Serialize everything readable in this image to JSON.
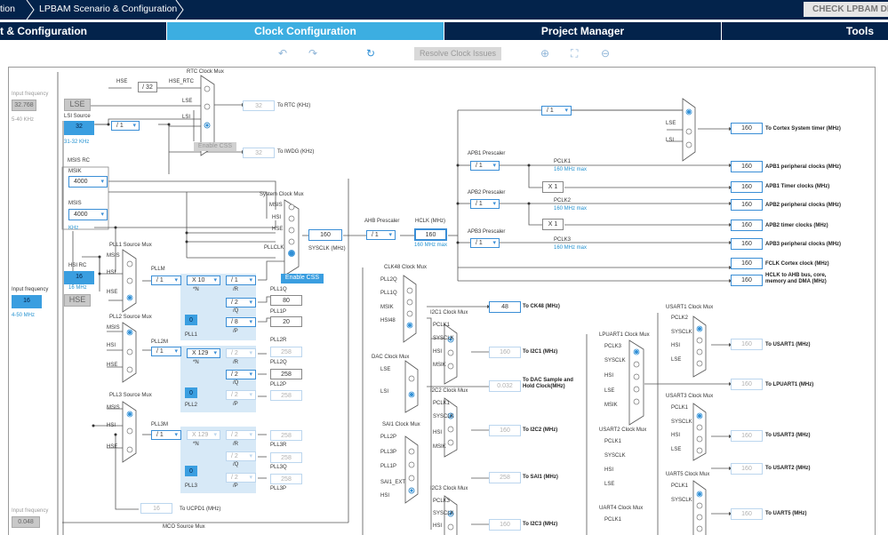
{
  "topbar": {
    "crumb1": "tion",
    "crumb2": "LPBAM Scenario & Configuration",
    "check": "CHECK LPBAM DE"
  },
  "tabs": [
    {
      "label": "t & Configuration"
    },
    {
      "label": "Clock Configuration"
    },
    {
      "label": "Project Manager"
    },
    {
      "label": "Tools"
    }
  ],
  "toolbar": {
    "undo": "↶",
    "redo": "↷",
    "refresh": "↻",
    "resolve": "Resolve Clock Issues",
    "zoom_in": "⊕",
    "fit": "⛶",
    "zoom_out": "⊖"
  },
  "left": {
    "in_freq": "Input frequency",
    "lse_val": "32.768",
    "lse_range": "5-40 KHz",
    "lse": "LSE",
    "lsi_src": "LSI Source",
    "lsi_val": "32",
    "lsi_range": "31-32 KHz",
    "msis_rc": "MSIS RC",
    "msik": "MSIK",
    "msik_val": "4000",
    "msis": "MSIS",
    "msis_val": "4000",
    "khz": "KHz",
    "hsi_rc": "HSI RC",
    "hsi_val": "16",
    "hsi_mhz": "16 MHz",
    "in_freq2": "Input frequency",
    "hse_val": "16",
    "hse": "HSE",
    "hse_range": "4-50 MHz",
    "in_freq3": "Input frequency",
    "in3_val": "0.048"
  },
  "rtc": {
    "title": "RTC Clock Mux",
    "hse": "HSE",
    "div32": "/ 32",
    "hse_rtc": "HSE_RTC",
    "lse": "LSE",
    "lsi": "LSI",
    "rtc_val": "32",
    "rtc_lbl": "To RTC (KHz)",
    "div1": "/ 1",
    "ecss": "Enable CSS",
    "iwdg_val": "32",
    "iwdg_lbl": "To IWDG (KHz)"
  },
  "sys": {
    "title": "System Clock Mux",
    "msis": "MSIS",
    "hsi": "HSI",
    "hse": "HSE",
    "pllclk": "PLLCLK",
    "ecss": "Enable CSS",
    "sysclk_val": "160",
    "sysclk": "SYSCLK (MHz)",
    "ahb": "AHB Prescaler",
    "ahb_div": "/ 1",
    "hclk": "HCLK (MHz)",
    "hclk_val": "160",
    "hclk_max": "160 MHz max"
  },
  "pll1": {
    "src": "PLL1 Source Mux",
    "msis": "MSIS",
    "hsi": "HSI",
    "hse": "HSE",
    "pllm": "PLLM",
    "m": "/ 1",
    "n": "X 10",
    "n_l": "*N",
    "r": "/ 1",
    "r_l": "/R",
    "q": "/ 2",
    "q_l": "/Q",
    "p": "/ 8",
    "p_l": "/P",
    "frac": "0",
    "name": "PLL1",
    "q_lbl": "PLL1Q",
    "q_val": "80",
    "p_lbl": "PLL1P",
    "p_val": "20"
  },
  "pll2": {
    "src": "PLL2 Source Mux",
    "msis": "MSIS",
    "hsi": "HSI",
    "hse": "HSE",
    "pllm": "PLL2M",
    "m": "/ 1",
    "n": "X 129",
    "n_l": "*N",
    "r": "/ 2",
    "r_l": "/R",
    "q": "/ 2",
    "q_l": "/Q",
    "p": "/ 2",
    "p_l": "/P",
    "frac": "0",
    "name": "PLL2",
    "r_lbl": "PLL2R",
    "r_val": "258",
    "q_lbl": "PLL2Q",
    "q_val": "258",
    "p_lbl": "PLL2P",
    "p_val": "258"
  },
  "pll3": {
    "src": "PLL3 Source Mux",
    "msis": "MSIS",
    "hsi": "HSI",
    "hse": "HSE",
    "pllm": "PLL3M",
    "m": "/ 1",
    "n": "X 129",
    "n_l": "*N",
    "r": "/ 2",
    "r_l": "/R",
    "q": "/ 2",
    "q_l": "/Q",
    "p": "/ 2",
    "p_l": "/P",
    "frac": "0",
    "name": "PLL3",
    "r_lbl": "PLL3R",
    "r_val": "258",
    "q_lbl": "PLL3Q",
    "q_val": "258",
    "p_lbl": "PLL3P",
    "p_val": "258"
  },
  "bottom": {
    "ucpd_val": "16",
    "ucpd": "To UCPD1 (MHz)",
    "mco": "MCO Source Mux"
  },
  "right": {
    "div1": "/ 1",
    "lse": "LSE",
    "lsi": "LSI",
    "cortex_val": "160",
    "cortex": "To Cortex System timer (MHz)",
    "apb1": "APB1 Prescaler",
    "apb1_div": "/ 1",
    "pclk1": "PCLK1",
    "pclk1_max": "160 MHz max",
    "x1a": "X 1",
    "apb1p_val": "160",
    "apb1p": "APB1 peripheral clocks (MHz)",
    "apb1t_val": "160",
    "apb1t": "APB1 Timer clocks (MHz)",
    "apb2": "APB2 Prescaler",
    "apb2_div": "/ 1",
    "pclk2": "PCLK2",
    "pclk2_max": "160 MHz max",
    "x1b": "X 1",
    "apb2p_val": "160",
    "apb2p": "APB2 peripheral clocks (MHz)",
    "apb2t_val": "160",
    "apb2t": "APB2 timer clocks (MHz)",
    "apb3": "APB3 Prescaler",
    "apb3_div": "/ 1",
    "pclk3": "PCLK3",
    "pclk3_max": "160 MHz max",
    "apb3p_val": "160",
    "apb3p": "APB3 peripheral clocks (MHz)",
    "fclk_val": "160",
    "fclk": "FCLK Cortex clock (MHz)",
    "ahb_val": "160",
    "ahb": "HCLK to AHB bus, core, memory and DMA (MHz)"
  },
  "clk48": {
    "title": "CLK48 Clock Mux",
    "pll2q": "PLL2Q",
    "pll1q": "PLL1Q",
    "msik": "MSIK",
    "hsi48": "HSI48",
    "val": "48",
    "lbl": "To CK48 (MHz)"
  },
  "i2c1": {
    "title": "I2C1 Clock Mux",
    "pclk": "PCLK1",
    "sysclk": "SYSCLK",
    "hsi": "HSI",
    "msik": "MSIK",
    "val": "160",
    "lbl": "To I2C1 (MHz)"
  },
  "dac": {
    "title": "DAC Clock Mux",
    "lse": "LSE",
    "lsi": "LSI",
    "val": "0.032",
    "lbl": "To DAC Sample and Hold Clock(MHz)"
  },
  "i2c2": {
    "title": "I2C2 Clock Mux",
    "pclk": "PCLK1",
    "sysclk": "SYSCLK",
    "hsi": "HSI",
    "msik": "MSIK",
    "val": "160",
    "lbl": "To I2C2 (MHz)"
  },
  "sai1": {
    "title": "SAI1 Clock Mux",
    "pll2p": "PLL2P",
    "pll3p": "PLL3P",
    "pll1p": "PLL1P",
    "ext": "SAI1_EXT",
    "hsi": "HSI",
    "val": "258",
    "lbl": "To SAI1 (MHz)"
  },
  "i2c3": {
    "title": "I2C3 Clock Mux",
    "pclk": "PCLK3",
    "sysclk": "SYSCLK",
    "hsi": "HSI",
    "val": "160",
    "lbl": "To I2C3 (MHz)"
  },
  "lpuart1": {
    "title": "LPUART1 Clock Mux",
    "pclk": "PCLK3",
    "sysclk": "SYSCLK",
    "hsi": "HSI",
    "lse": "LSE",
    "msik": "MSIK",
    "val": "160",
    "lbl": "To LPUART1 (MHz)"
  },
  "usart1": {
    "title": "USART1 Clock Mux",
    "pclk": "PCLK2",
    "sysclk": "SYSCLK",
    "hsi": "HSI",
    "lse": "LSE",
    "val": "160",
    "lbl": "To USART1 (MHz)"
  },
  "usart3": {
    "title": "USART3 Clock Mux",
    "pclk": "PCLK1",
    "sysclk": "SYSCLK",
    "hsi": "HSI",
    "lse": "LSE",
    "val": "160",
    "lbl": "To USART3 (MHz)"
  },
  "usart2": {
    "title": "USART2 Clock Mux",
    "pclk": "PCLK1",
    "sysclk": "SYSCLK",
    "hsi": "HSI",
    "lse": "LSE",
    "val": "160",
    "lbl": "To USART2 (MHz)"
  },
  "uart5": {
    "title": "UART5 Clock Mux",
    "pclk": "PCLK1",
    "sysclk": "SYSCLK",
    "val": "160",
    "lbl": "To UART5 (MHz)"
  },
  "uart4": {
    "title": "UART4 Clock Mux",
    "pclk": "PCLK1"
  }
}
